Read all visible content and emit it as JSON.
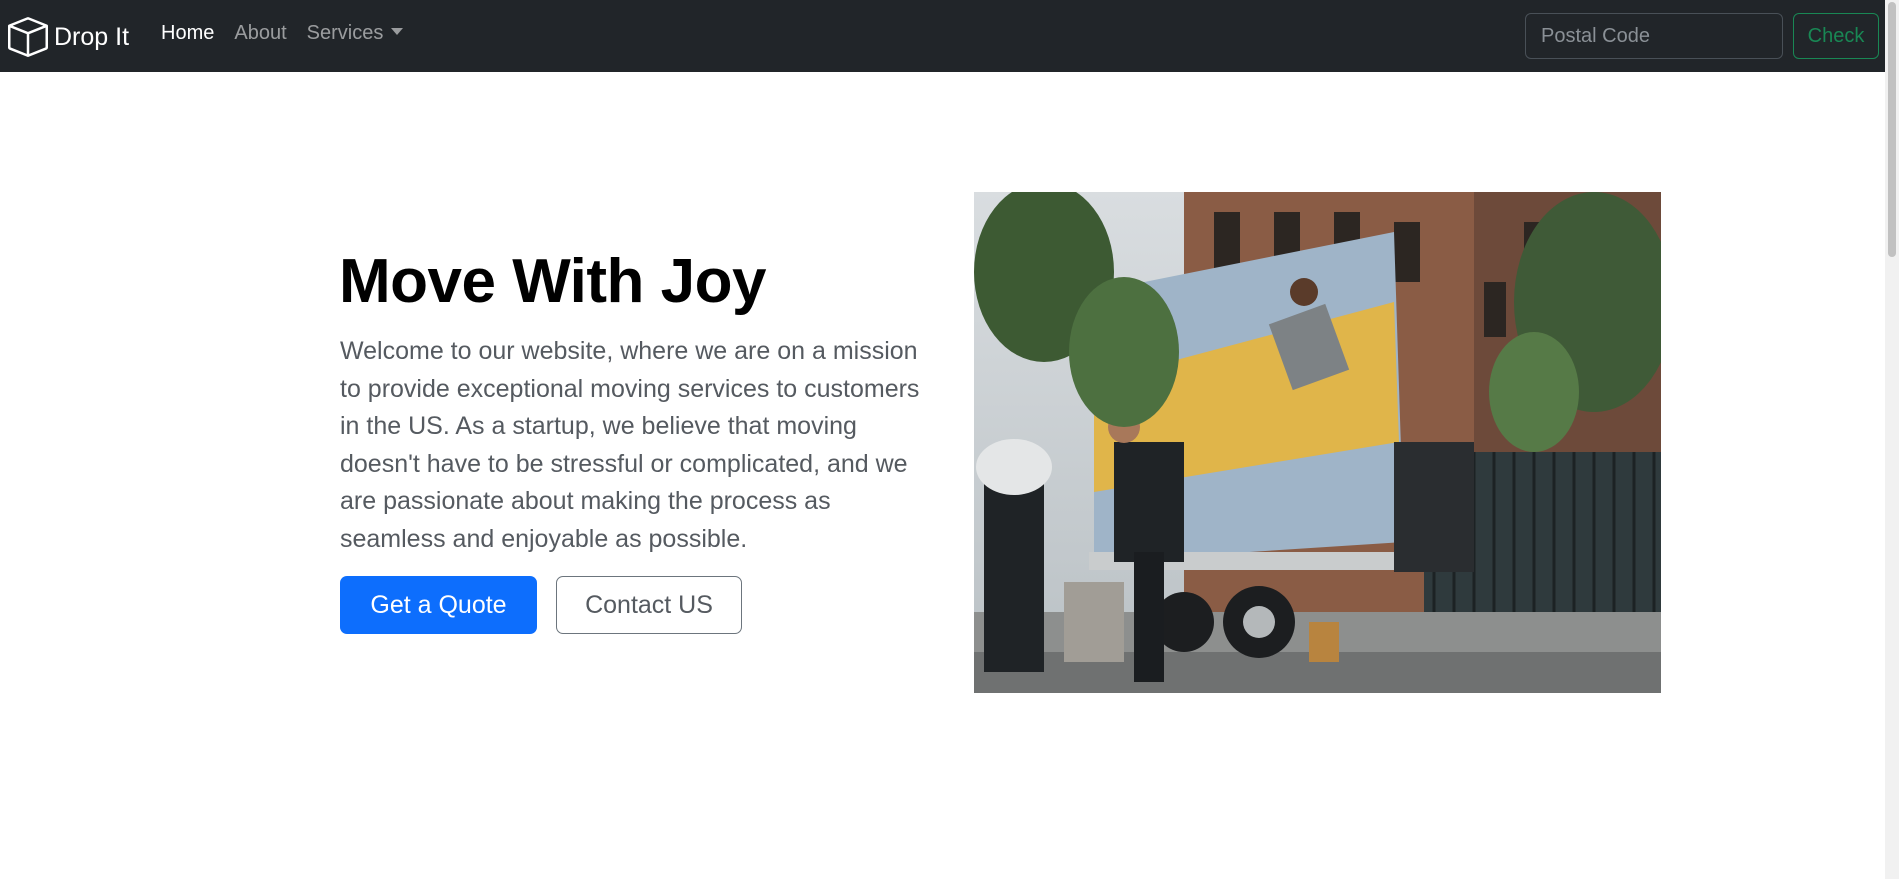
{
  "navbar": {
    "brand": "Drop It",
    "links": [
      {
        "label": "Home",
        "active": true
      },
      {
        "label": "About",
        "active": false
      },
      {
        "label": "Services",
        "active": false
      }
    ],
    "search": {
      "placeholder": "Postal Code",
      "value": "",
      "button_label": "Check"
    }
  },
  "hero": {
    "title": "Move With Joy",
    "text": "Welcome to our website, where we are on a mission to provide exceptional moving services to customers in the US. As a startup, we believe that moving doesn't have to be stressful or complicated, and we are passionate about making the process as seamless and enjoyable as possible.",
    "primary_button": "Get a Quote",
    "secondary_button": "Contact US"
  },
  "colors": {
    "navbar_bg": "#212529",
    "primary": "#0d6efd",
    "success": "#198754"
  },
  "icons": {
    "brand": "box-icon",
    "services_toggle": "caret-down-icon"
  }
}
